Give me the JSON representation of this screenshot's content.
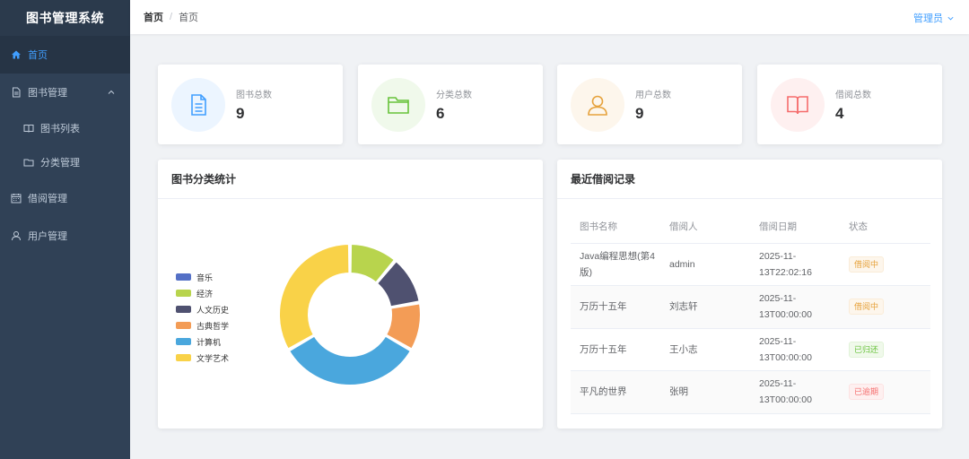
{
  "app": {
    "title": "图书管理系统"
  },
  "sidebar": {
    "items": [
      {
        "label": "首页",
        "icon": "home-icon",
        "active": true
      },
      {
        "label": "图书管理",
        "icon": "document-icon",
        "expanded": true
      },
      {
        "label": "图书列表",
        "icon": "book-icon",
        "sub": true
      },
      {
        "label": "分类管理",
        "icon": "folder-icon",
        "sub": true
      },
      {
        "label": "借阅管理",
        "icon": "calendar-icon"
      },
      {
        "label": "用户管理",
        "icon": "user-icon"
      }
    ]
  },
  "header": {
    "breadcrumb": {
      "home": "首页",
      "separator": "/",
      "current": "首页"
    },
    "user": "管理员"
  },
  "stats": [
    {
      "label": "图书总数",
      "value": "9",
      "icon": "document-icon",
      "color": "#409eff",
      "bg": "#ecf5ff"
    },
    {
      "label": "分类总数",
      "value": "6",
      "icon": "folder-icon",
      "color": "#67c23a",
      "bg": "#f0f9eb"
    },
    {
      "label": "用户总数",
      "value": "9",
      "icon": "user-icon",
      "color": "#e6a23c",
      "bg": "#fdf6ec"
    },
    {
      "label": "借阅总数",
      "value": "4",
      "icon": "book-open-icon",
      "color": "#f56c6c",
      "bg": "#fef0f0"
    }
  ],
  "category_panel": {
    "title": "图书分类统计",
    "chart_data": {
      "type": "pie",
      "donut": true,
      "legend_position": "left",
      "categories": [
        "音乐",
        "经济",
        "人文历史",
        "古典哲学",
        "计算机",
        "文学艺术"
      ],
      "values": [
        0,
        1,
        1,
        1,
        3,
        3
      ],
      "colors": [
        "#5470c6",
        "#b8d44d",
        "#4f5170",
        "#f39c56",
        "#4aa7dd",
        "#f9d248"
      ]
    }
  },
  "borrow_panel": {
    "title": "最近借阅记录",
    "columns": [
      "图书名称",
      "借阅人",
      "借阅日期",
      "状态"
    ],
    "rows": [
      {
        "book": "Java编程思想(第4版)",
        "borrower": "admin",
        "date": "2025-11-13T22:02:16",
        "status": "借阅中",
        "status_type": "warning"
      },
      {
        "book": "万历十五年",
        "borrower": "刘志轩",
        "date": "2025-11-13T00:00:00",
        "status": "借阅中",
        "status_type": "warning"
      },
      {
        "book": "万历十五年",
        "borrower": "王小志",
        "date": "2025-11-13T00:00:00",
        "status": "已归还",
        "status_type": "success"
      },
      {
        "book": "平凡的世界",
        "borrower": "张明",
        "date": "2025-11-13T00:00:00",
        "status": "已逾期",
        "status_type": "danger"
      }
    ]
  }
}
